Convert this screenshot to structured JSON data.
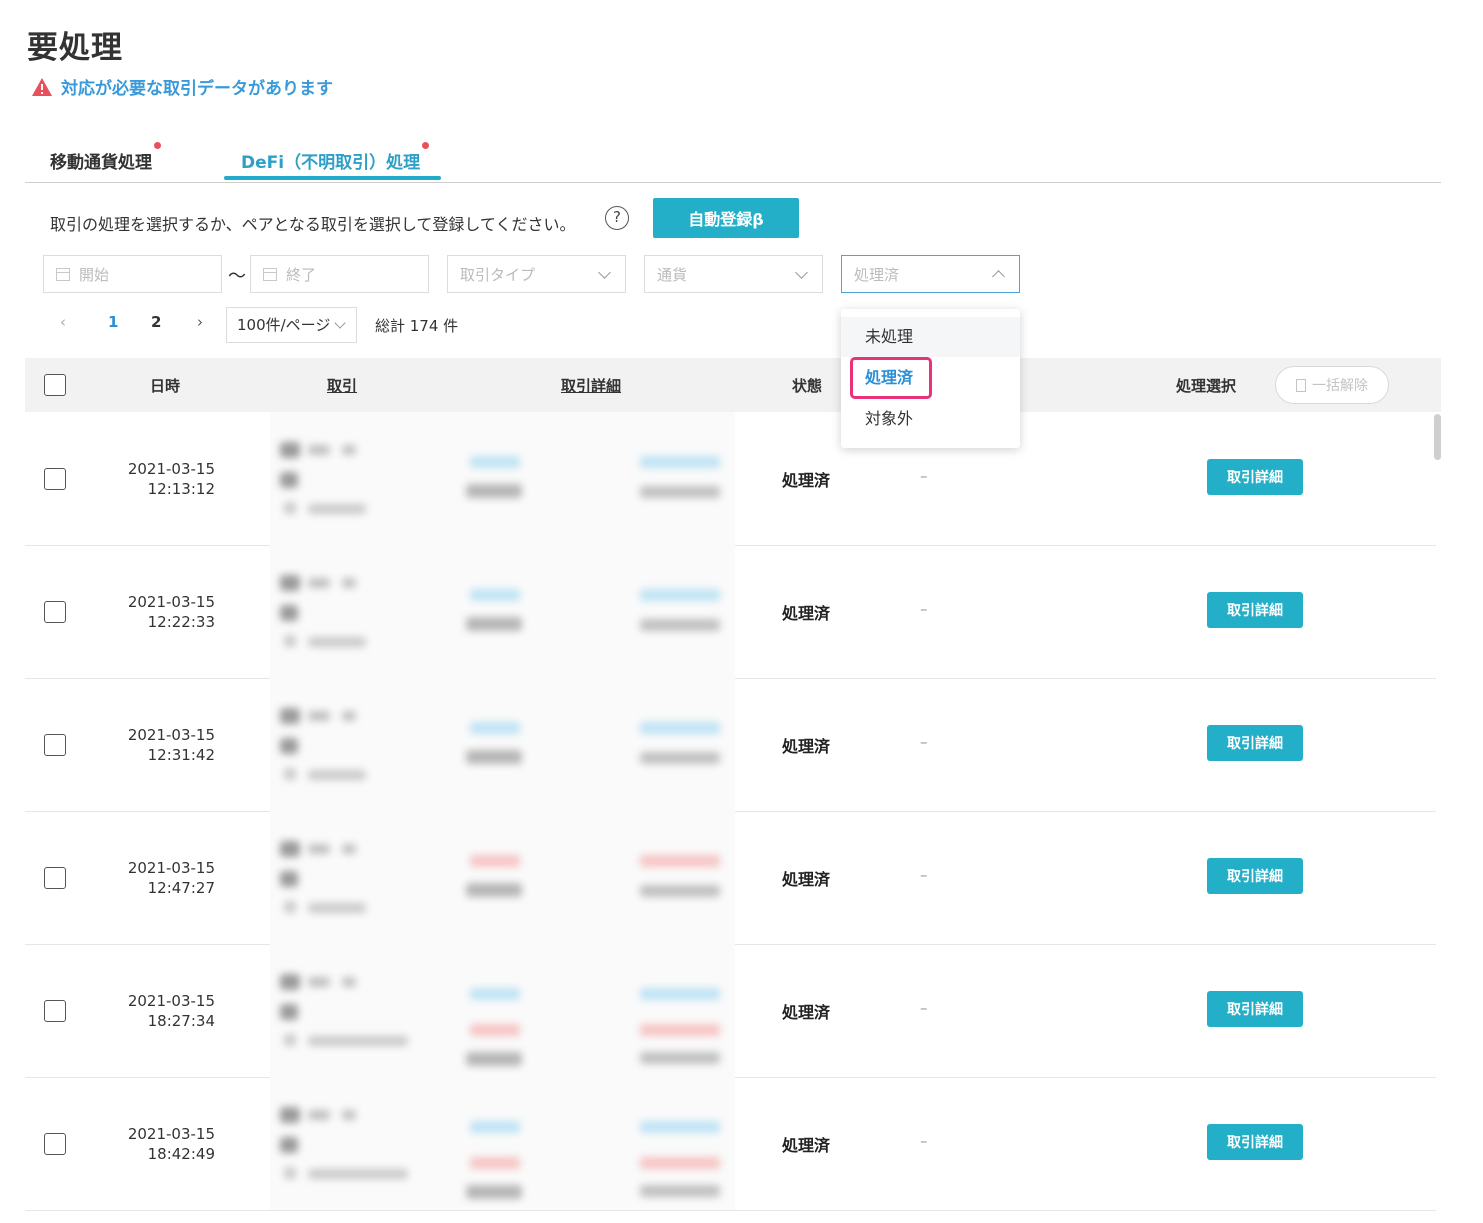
{
  "page": {
    "title": "要処理",
    "warning": "対応が必要な取引データがあります"
  },
  "tabs": [
    {
      "label": "移動通貨処理"
    },
    {
      "label": "DeFi（不明取引）処理"
    }
  ],
  "instruction": "取引の処理を選択するか、ペアとなる取引を選択して登録してください。",
  "help_symbol": "?",
  "auto_button": "自動登録β",
  "filters": {
    "start_placeholder": "開始",
    "tilde": "～",
    "end_placeholder": "終了",
    "type_placeholder": "取引タイプ",
    "currency_placeholder": "通貨",
    "status_value": "処理済"
  },
  "pagination": {
    "prev": "‹",
    "pages": [
      "1",
      "2"
    ],
    "next": "›",
    "per_page": "100件/ページ",
    "total": "総計 174 件"
  },
  "table": {
    "headers": {
      "datetime": "日時",
      "transaction": "取引",
      "transaction_detail": "取引詳細",
      "status": "状態",
      "process_select": "処理選択",
      "bulk_release": "一括解除"
    },
    "rows": [
      {
        "date": "2021-03-15",
        "time": "12:13:12",
        "status": "処理済",
        "dash": "–",
        "button": "取引詳細"
      },
      {
        "date": "2021-03-15",
        "time": "12:22:33",
        "status": "処理済",
        "dash": "–",
        "button": "取引詳細"
      },
      {
        "date": "2021-03-15",
        "time": "12:31:42",
        "status": "処理済",
        "dash": "–",
        "button": "取引詳細"
      },
      {
        "date": "2021-03-15",
        "time": "12:47:27",
        "status": "処理済",
        "dash": "–",
        "button": "取引詳細"
      },
      {
        "date": "2021-03-15",
        "time": "18:27:34",
        "status": "処理済",
        "dash": "–",
        "button": "取引詳細"
      },
      {
        "date": "2021-03-15",
        "time": "18:42:49",
        "status": "処理済",
        "dash": "–",
        "button": "取引詳細"
      }
    ]
  },
  "dropdown": {
    "options": [
      "未処理",
      "処理済",
      "対象外"
    ],
    "selected": "処理済"
  },
  "colors": {
    "accent": "#23afc8",
    "link_blue": "#2a8fd6",
    "warning_red": "#e8505b",
    "highlight_pink": "#e8337a"
  }
}
